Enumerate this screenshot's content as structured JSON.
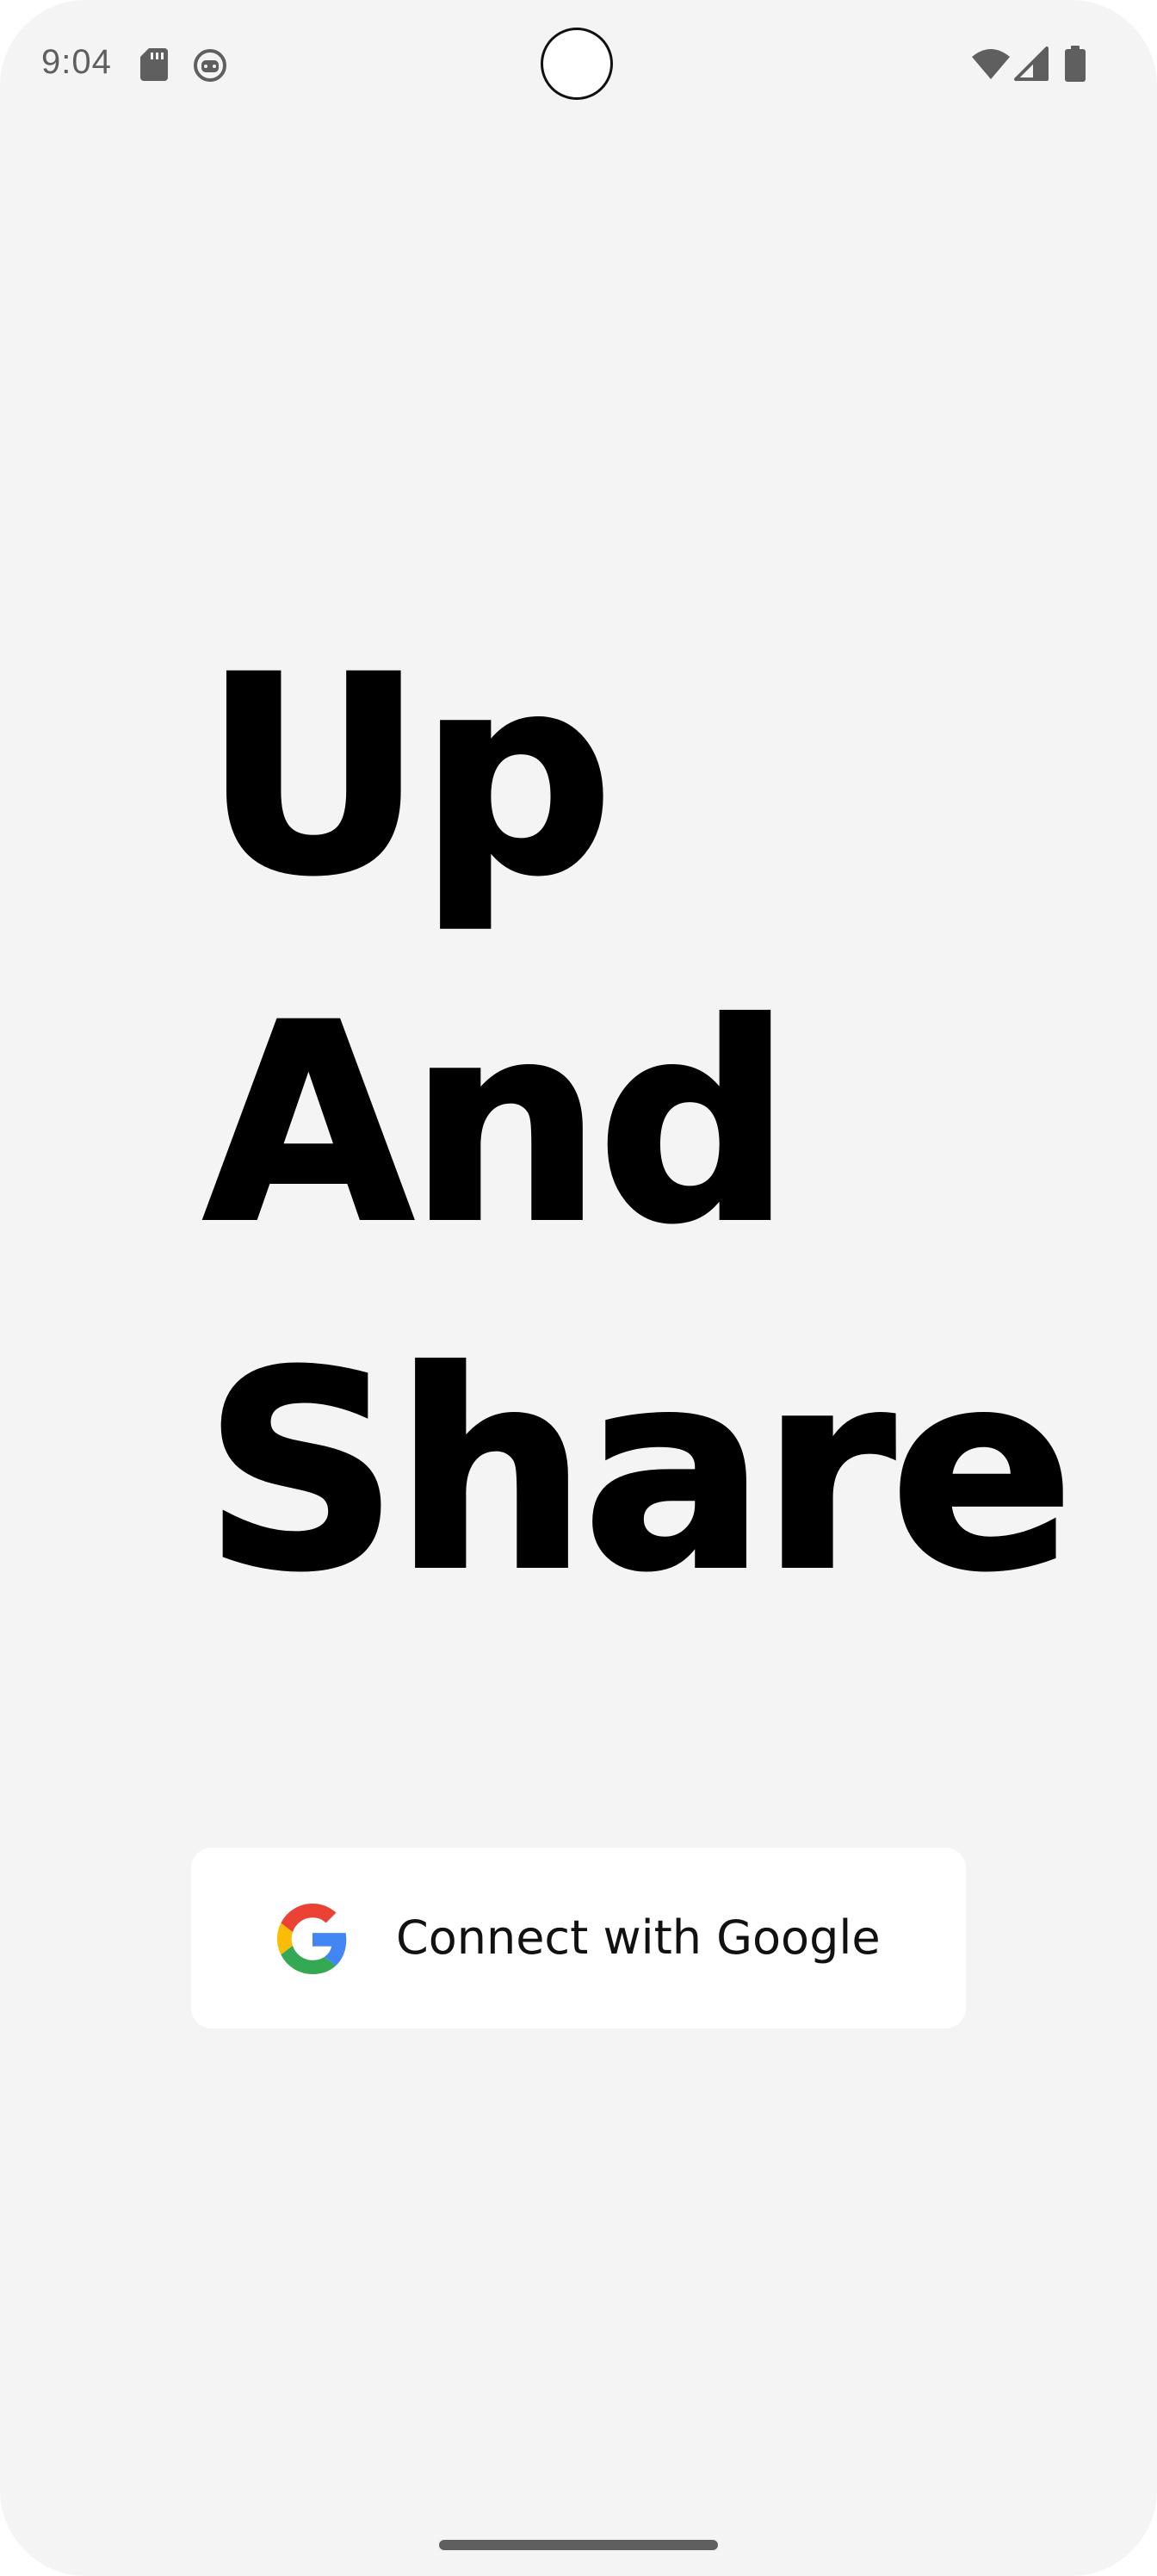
{
  "status_bar": {
    "time": "9:04",
    "icons": [
      "sd-card-icon",
      "sync-face-icon",
      "wifi-icon",
      "cell-signal-icon",
      "battery-icon"
    ]
  },
  "hero": {
    "lines": [
      "Up",
      "And",
      "Share"
    ]
  },
  "auth": {
    "google_button_label": "Connect with Google",
    "icon": "google-g-icon"
  },
  "colors": {
    "background": "#f4f4f4",
    "button_background": "#ffffff",
    "text": "#000000",
    "status_icons": "#5f5f5f",
    "google_red": "#EA4335",
    "google_yellow": "#FBBC05",
    "google_green": "#34A853",
    "google_blue": "#4285F4"
  }
}
